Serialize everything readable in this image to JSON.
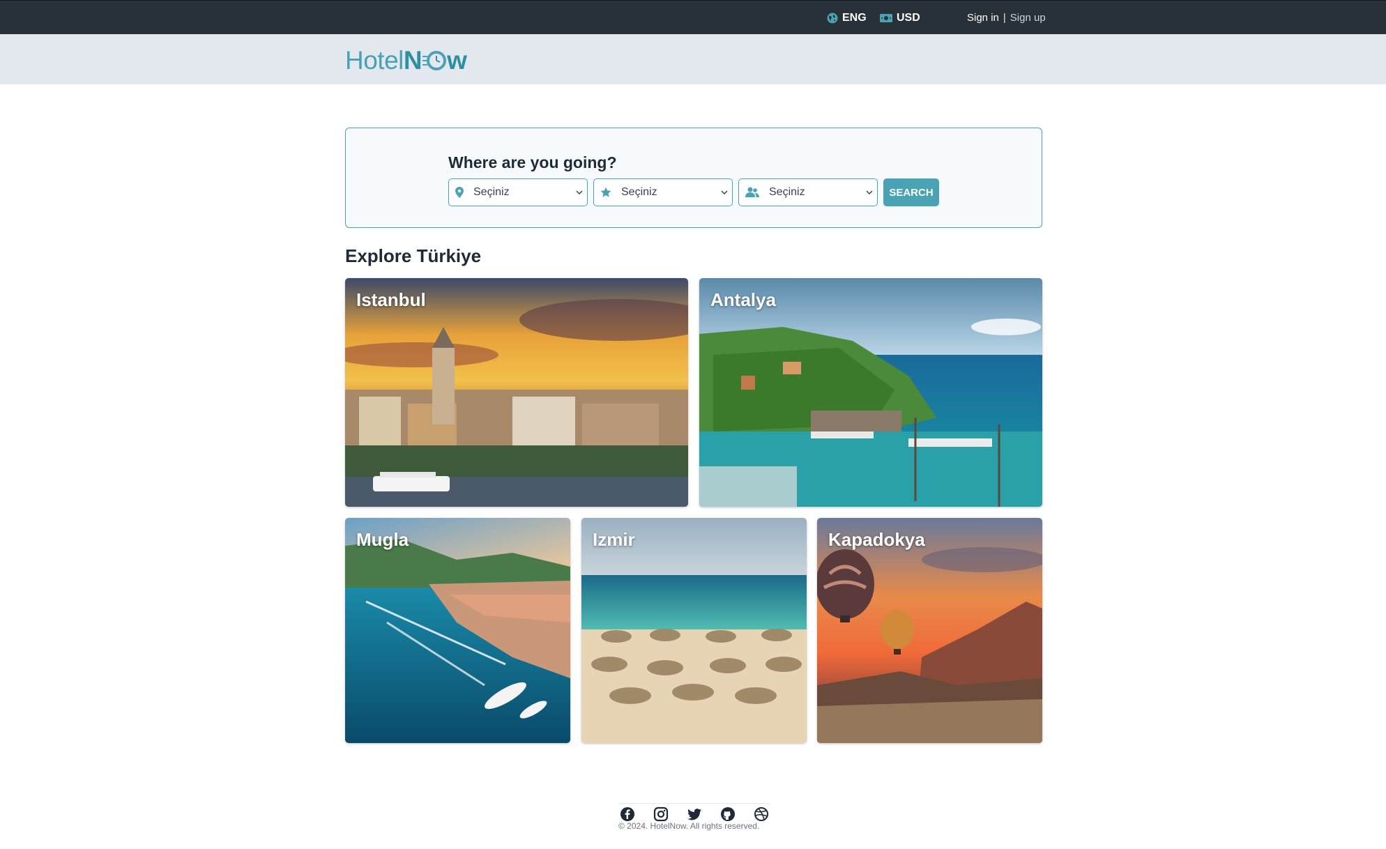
{
  "topbar": {
    "language": "ENG",
    "currency": "USD",
    "sign_in": "Sign in",
    "separator": "|",
    "sign_up": "Sign up"
  },
  "header": {
    "logo_part1": "Hotel",
    "logo_part2": "N",
    "logo_part3": "w"
  },
  "search": {
    "title": "Where are you going?",
    "location_value": "Seçiniz",
    "stars_value": "Seçiniz",
    "guests_value": "Seçiniz",
    "button_label": "SEARCH"
  },
  "explore": {
    "title": "Explore Türkiye",
    "cards": [
      {
        "label": "Istanbul"
      },
      {
        "label": "Antalya"
      },
      {
        "label": "Mugla"
      },
      {
        "label": "Izmir"
      },
      {
        "label": "Kapadokya"
      }
    ]
  },
  "footer": {
    "icons": [
      "facebook-icon",
      "instagram-icon",
      "twitter-icon",
      "github-icon",
      "dribbble-icon"
    ],
    "copyright": "© 2024. HotelNow. All rights reserved."
  },
  "colors": {
    "accent": "#4aa3b4",
    "topbar_bg": "#283038",
    "header_bg": "#e3e8ef"
  }
}
